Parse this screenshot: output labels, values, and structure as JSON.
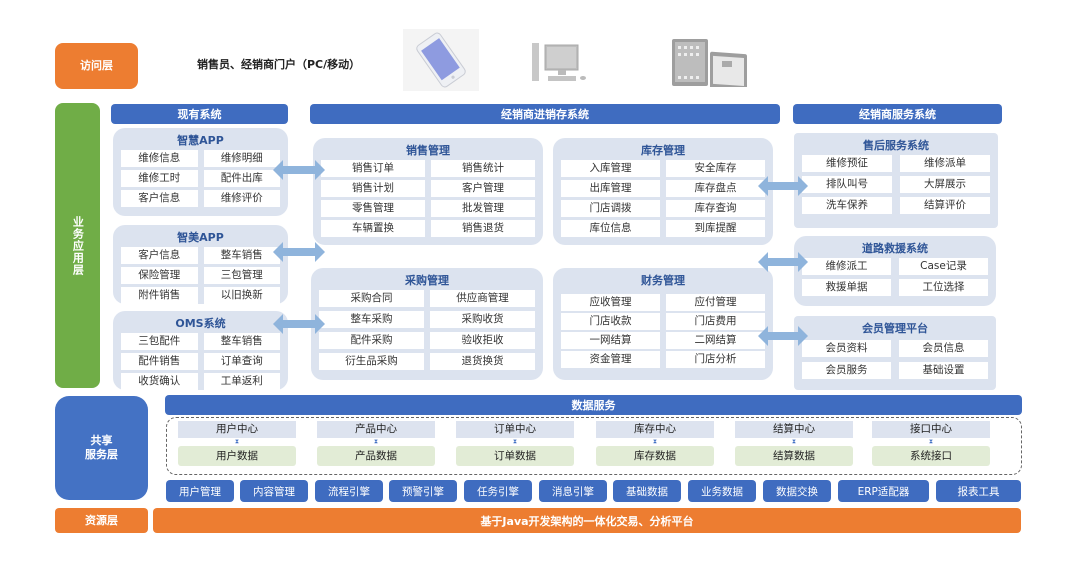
{
  "access_layer": {
    "label": "访问层",
    "portal_text": "销售员、经销商门户（PC/移动）",
    "devices": [
      "smartphone-icon",
      "desktop-computer-icon",
      "tablet-icon"
    ]
  },
  "business_layer": {
    "label": "业务应用层",
    "existing_systems": {
      "header": "现有系统",
      "modules": [
        {
          "title": "智慧APP",
          "items": [
            "维修信息",
            "维修明细",
            "维修工时",
            "配件出库",
            "客户信息",
            "维修评价"
          ]
        },
        {
          "title": "智美APP",
          "items": [
            "客户信息",
            "整车销售",
            "保险管理",
            "三包管理",
            "附件销售",
            "以旧换新"
          ]
        },
        {
          "title": "OMS系统",
          "items": [
            "三包配件",
            "整车销售",
            "配件销售",
            "订单查询",
            "收货确认",
            "工单返利"
          ]
        }
      ]
    },
    "dms": {
      "header": "经销商进销存系统",
      "modules": [
        {
          "title": "销售管理",
          "items": [
            "销售订单",
            "销售统计",
            "销售计划",
            "客户管理",
            "零售管理",
            "批发管理",
            "车辆置换",
            "销售退货"
          ]
        },
        {
          "title": "库存管理",
          "items": [
            "入库管理",
            "安全库存",
            "出库管理",
            "库存盘点",
            "门店调拨",
            "库存查询",
            "库位信息",
            "到库提醒"
          ]
        },
        {
          "title": "采购管理",
          "items": [
            "采购合同",
            "供应商管理",
            "整车采购",
            "采购收货",
            "配件采购",
            "验收拒收",
            "衍生品采购",
            "退货换货"
          ]
        },
        {
          "title": "财务管理",
          "items": [
            "应收管理",
            "应付管理",
            "门店收款",
            "门店费用",
            "一网结算",
            "二网结算",
            "资金管理",
            "门店分析"
          ]
        }
      ]
    },
    "dealer_services": {
      "header": "经销商服务系统",
      "modules": [
        {
          "title": "售后服务系统",
          "items": [
            "维修预征",
            "维修派单",
            "排队叫号",
            "大屏展示",
            "洗车保养",
            "结算评价"
          ]
        },
        {
          "title": "道路救援系统",
          "items": [
            "维修派工",
            "Case记录",
            "救援单据",
            "工位选择"
          ]
        },
        {
          "title": "会员管理平台",
          "items": [
            "会员资料",
            "会员信息",
            "会员服务",
            "基础设置"
          ]
        }
      ]
    }
  },
  "shared_layer": {
    "label_line1": "共享",
    "label_line2": "服务层",
    "data_services": "数据服务",
    "centers": [
      {
        "center": "用户中心",
        "data": "用户数据"
      },
      {
        "center": "产品中心",
        "data": "产品数据"
      },
      {
        "center": "订单中心",
        "data": "订单数据"
      },
      {
        "center": "库存中心",
        "data": "库存数据"
      },
      {
        "center": "结算中心",
        "data": "结算数据"
      },
      {
        "center": "接口中心",
        "data": "系统接口"
      }
    ],
    "tools": [
      "用户管理",
      "内容管理",
      "流程引擎",
      "预警引擎",
      "任务引擎",
      "消息引擎",
      "基础数据",
      "业务数据",
      "数据交换",
      "ERP适配器",
      "报表工具"
    ]
  },
  "resource_layer": {
    "label": "资源层",
    "platform": "基于Java开发架构的一体化交易、分析平台"
  },
  "colors": {
    "orange": "#ed7d31",
    "green": "#70ad47",
    "blue": "#3f6cc0",
    "module_bg": "#dce3ef",
    "module_title": "#2f5597",
    "data_green": "#e2ecd6",
    "arrow": "#8fb4dc"
  }
}
